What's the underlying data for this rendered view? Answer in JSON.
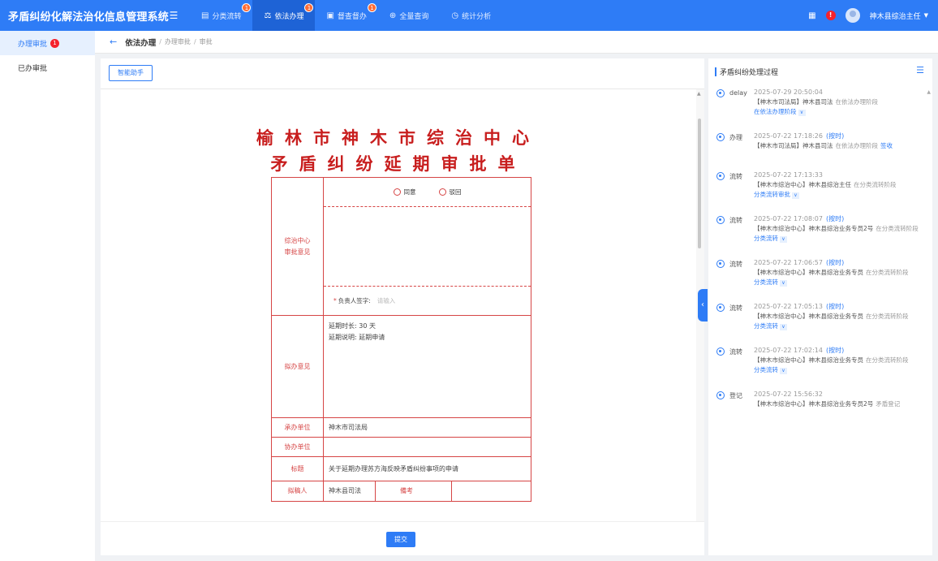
{
  "header": {
    "title": "矛盾纠纷化解法治化信息管理系统",
    "nav": [
      {
        "label": "分类流转",
        "badge": "1",
        "active": false,
        "icon": "list-icon"
      },
      {
        "label": "依法办理",
        "badge": "1",
        "active": true,
        "icon": "hammer-icon"
      },
      {
        "label": "督查督办",
        "badge": "1",
        "active": false,
        "icon": "doc-icon"
      },
      {
        "label": "全量查询",
        "badge": "",
        "active": false,
        "icon": "search-icon"
      },
      {
        "label": "统计分析",
        "badge": "",
        "active": false,
        "icon": "clock-icon"
      }
    ],
    "user": "神木县综治主任",
    "alert": "!"
  },
  "sidebar": {
    "items": [
      {
        "label": "办理审批",
        "badge": "1"
      },
      {
        "label": "已办审批",
        "badge": ""
      }
    ]
  },
  "breadcrumb": {
    "main": "依法办理",
    "sub1": "办理审批",
    "sub2": "审批"
  },
  "main": {
    "assist_label": "智能助手",
    "submit_label": "提交",
    "doc_title_line1": "榆林市神木市综治中心",
    "doc_title_line2": "矛盾纠纷延期审批单",
    "form": {
      "label_center_opinion": "综治中心审批意见",
      "agree": "同意",
      "reject": "驳回",
      "sign_label": "负责人签字:",
      "sign_placeholder": "请输入",
      "label_proposed": "拟办意见",
      "delay_duration": "延期时长: 30 天",
      "delay_note": "延期说明: 延期申请",
      "label_undertaking": "承办单位",
      "undertaking": "神木市司法局",
      "label_assisting": "协办单位",
      "assisting": "",
      "label_title": "标题",
      "title_value": "关于延期办理苏方海反映矛盾纠纷事项的申请",
      "label_drafter": "拟稿人",
      "drafter": "神木县司法",
      "label_remark": "備考",
      "remark": ""
    }
  },
  "process": {
    "title": "矛盾纠纷处理过程",
    "items": [
      {
        "type": "delay",
        "time": "2025-07-29 20:50:04",
        "tag": "",
        "org": "【神木市司法局】神木县司法",
        "stage": "在依法办理阶段",
        "op": "",
        "link": "在依法办理阶段"
      },
      {
        "type": "办理",
        "time": "2025-07-22 17:18:26",
        "tag": "(按时)",
        "org": "【神木市司法局】神木县司法",
        "stage": "在依法办理阶段",
        "op": "签收",
        "link": ""
      },
      {
        "type": "流转",
        "time": "2025-07-22 17:13:33",
        "tag": "",
        "org": "【神木市综治中心】神木县综治主任",
        "stage": "在分类流转阶段",
        "op": "",
        "link": "分类流转审批"
      },
      {
        "type": "流转",
        "time": "2025-07-22 17:08:07",
        "tag": "(按时)",
        "org": "【神木市综治中心】神木县综治业务专员2号",
        "stage": "在分类流转阶段",
        "op": "",
        "link": "分类流转"
      },
      {
        "type": "流转",
        "time": "2025-07-22 17:06:57",
        "tag": "(按时)",
        "org": "【神木市综治中心】神木县综治业务专员",
        "stage": "在分类流转阶段",
        "op": "",
        "link": "分类流转"
      },
      {
        "type": "流转",
        "time": "2025-07-22 17:05:13",
        "tag": "(按时)",
        "org": "【神木市综治中心】神木县综治业务专员",
        "stage": "在分类流转阶段",
        "op": "",
        "link": "分类流转"
      },
      {
        "type": "流转",
        "time": "2025-07-22 17:02:14",
        "tag": "(按时)",
        "org": "【神木市综治中心】神木县综治业务专员",
        "stage": "在分类流转阶段",
        "op": "",
        "link": "分类流转"
      },
      {
        "type": "登记",
        "time": "2025-07-22 15:56:32",
        "tag": "",
        "org": "【神木市综治中心】神木县综治业务专员2号",
        "stage": "矛盾登记",
        "op": "",
        "link": ""
      }
    ]
  }
}
